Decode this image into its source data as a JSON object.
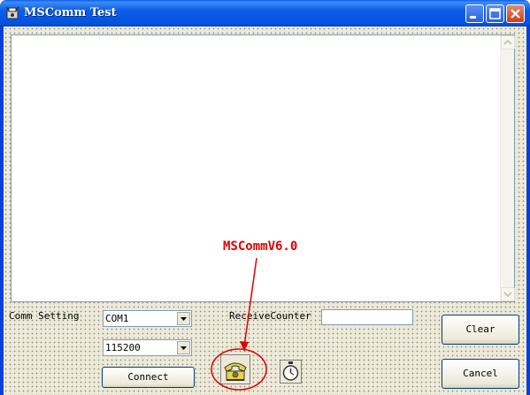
{
  "window": {
    "title": "MSComm Test"
  },
  "main": {
    "output_text": ""
  },
  "controls": {
    "comm_setting_label": "Comm Setting",
    "port_value": "COM1",
    "baud_value": "115200",
    "connect_label": "Connect",
    "receive_counter_label": "ReceiveCounter",
    "receive_counter_value": "",
    "clear_label": "Clear",
    "cancel_label": "Cancel"
  },
  "icons": {
    "app": "app-icon",
    "mscomm_control": "telephone-icon",
    "timer_control": "stopwatch-icon"
  },
  "annotation": {
    "text": "MSCommV6.0",
    "color": "#e00000"
  },
  "colors": {
    "titlebar": "#0553e0",
    "client_bg": "#ece9d8",
    "close_button": "#c8401c"
  }
}
